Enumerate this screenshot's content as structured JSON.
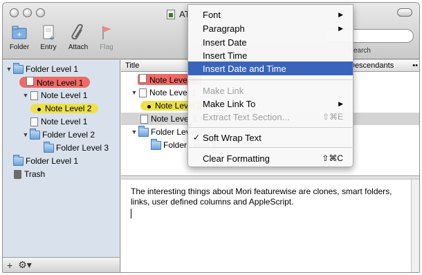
{
  "window": {
    "title": "AT",
    "title_ghost": "Note Level 1"
  },
  "toolbar": {
    "buttons": [
      {
        "label": "Folder",
        "icon": "folder-add-icon"
      },
      {
        "label": "Entry",
        "icon": "entry-add-icon"
      },
      {
        "label": "Attach",
        "icon": "paperclip-icon"
      },
      {
        "label": "Flag",
        "icon": "flag-icon"
      }
    ],
    "search_label": "Search"
  },
  "sidebar": {
    "items": [
      {
        "label": "Folder Level 1",
        "icon": "folder-icon",
        "expanded": true,
        "highlight": ""
      },
      {
        "label": "Note Level 1",
        "icon": "note-icon",
        "highlight": "red"
      },
      {
        "label": "Note Level 1",
        "icon": "note-icon",
        "expanded": true,
        "highlight": ""
      },
      {
        "label": "Note Level 2",
        "icon": "bullet-icon",
        "highlight": "yellow"
      },
      {
        "label": "Note Level 1",
        "icon": "note-icon",
        "highlight": ""
      },
      {
        "label": "Folder Level 2",
        "icon": "folder-icon",
        "expanded": true,
        "highlight": ""
      },
      {
        "label": "Folder Level 3",
        "icon": "folder-icon",
        "highlight": ""
      },
      {
        "label": "Folder Level 1",
        "icon": "folder-icon",
        "highlight": ""
      },
      {
        "label": "Trash",
        "icon": "trash-icon",
        "highlight": ""
      }
    ],
    "bottom_add": "+",
    "bottom_action": "⚙▾"
  },
  "list": {
    "col_title": "Title",
    "col_descendants": "Descendants",
    "col_more": "••",
    "rows": [
      {
        "label": "Note Level 1",
        "highlight": "red"
      },
      {
        "label": "Note Level 1",
        "highlight": ""
      },
      {
        "label": "Note Level 2",
        "highlight": "yellow"
      },
      {
        "label": "Note Level 1",
        "highlight": ""
      },
      {
        "label": "Folder Level 2",
        "highlight": ""
      },
      {
        "label": "Folder Level 3",
        "highlight": ""
      }
    ]
  },
  "editor": {
    "text": "The interesting things about Mori featurewise are clones, smart folders, links, user defined columns and AppleScript."
  },
  "context_menu": {
    "items": [
      {
        "label": "Font",
        "submenu": true,
        "enabled": true
      },
      {
        "label": "Paragraph",
        "submenu": true,
        "enabled": true
      },
      {
        "label": "Insert Date",
        "enabled": true
      },
      {
        "label": "Insert Time",
        "enabled": true
      },
      {
        "label": "Insert Date and Time",
        "enabled": true,
        "active": true
      },
      {
        "label": "Make Link",
        "enabled": false
      },
      {
        "label": "Make Link To",
        "submenu": true,
        "enabled": true
      },
      {
        "label": "Extract Text Section...",
        "shortcut": "⇧⌘E",
        "enabled": false
      },
      {
        "label": "Soft Wrap Text",
        "checked": true,
        "enabled": true
      },
      {
        "label": "Clear Formatting",
        "shortcut": "⇧⌘C",
        "enabled": true
      }
    ]
  },
  "colors": {
    "menu_highlight": "#3a64bc",
    "label_red": "#ee6a66",
    "label_yellow": "#ede14a",
    "sidebar_bg": "#d9e2ec"
  }
}
